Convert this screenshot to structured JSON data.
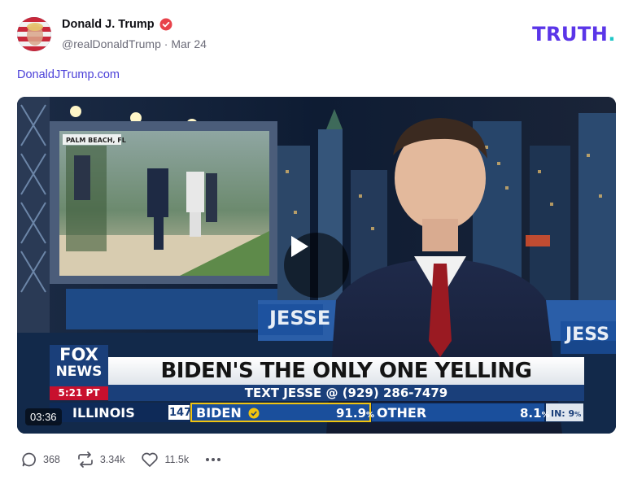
{
  "post": {
    "author_name": "Donald J. Trump",
    "handle": "@realDonaldTrump",
    "separator": "·",
    "date": "Mar 24",
    "link_text": "DonaldJTrump.com",
    "platform_logo": "TRUTH",
    "platform_logo_dot": "."
  },
  "video": {
    "duration": "03:36",
    "headline": "BIDEN'S THE ONLY ONE YELLING",
    "subline": "TEXT JESSE @ (929) 286-7479",
    "network_top": "FOX",
    "network_bottom": "NEWS",
    "time": "5:21 PT",
    "location_label": "PALM BEACH, FL",
    "show_tag_left": "JESSE",
    "show_tag_right": "JESS",
    "ticker": {
      "state": "ILLINOIS",
      "count": "147",
      "candidate1": "BIDEN",
      "candidate1_pct": "91.9",
      "candidate2": "OTHER",
      "candidate2_pct": "8.1",
      "pct_sign": "%",
      "reporting": "IN: 9",
      "reporting_pct": "%"
    }
  },
  "actions": {
    "replies": "368",
    "retruths": "3.34k",
    "likes": "11.5k"
  },
  "icons": {
    "verified": "verified-badge-icon",
    "reply": "comment-icon",
    "retruth": "repost-icon",
    "like": "heart-icon",
    "more": "more-icon",
    "play": "play-icon"
  },
  "colors": {
    "brand": "#5a35e8",
    "brand_dot": "#21c7c7",
    "link": "#4a3fd8",
    "verified": "#e8424a",
    "fox_red": "#c8102e",
    "ticker_blue": "#1a4f9c"
  }
}
